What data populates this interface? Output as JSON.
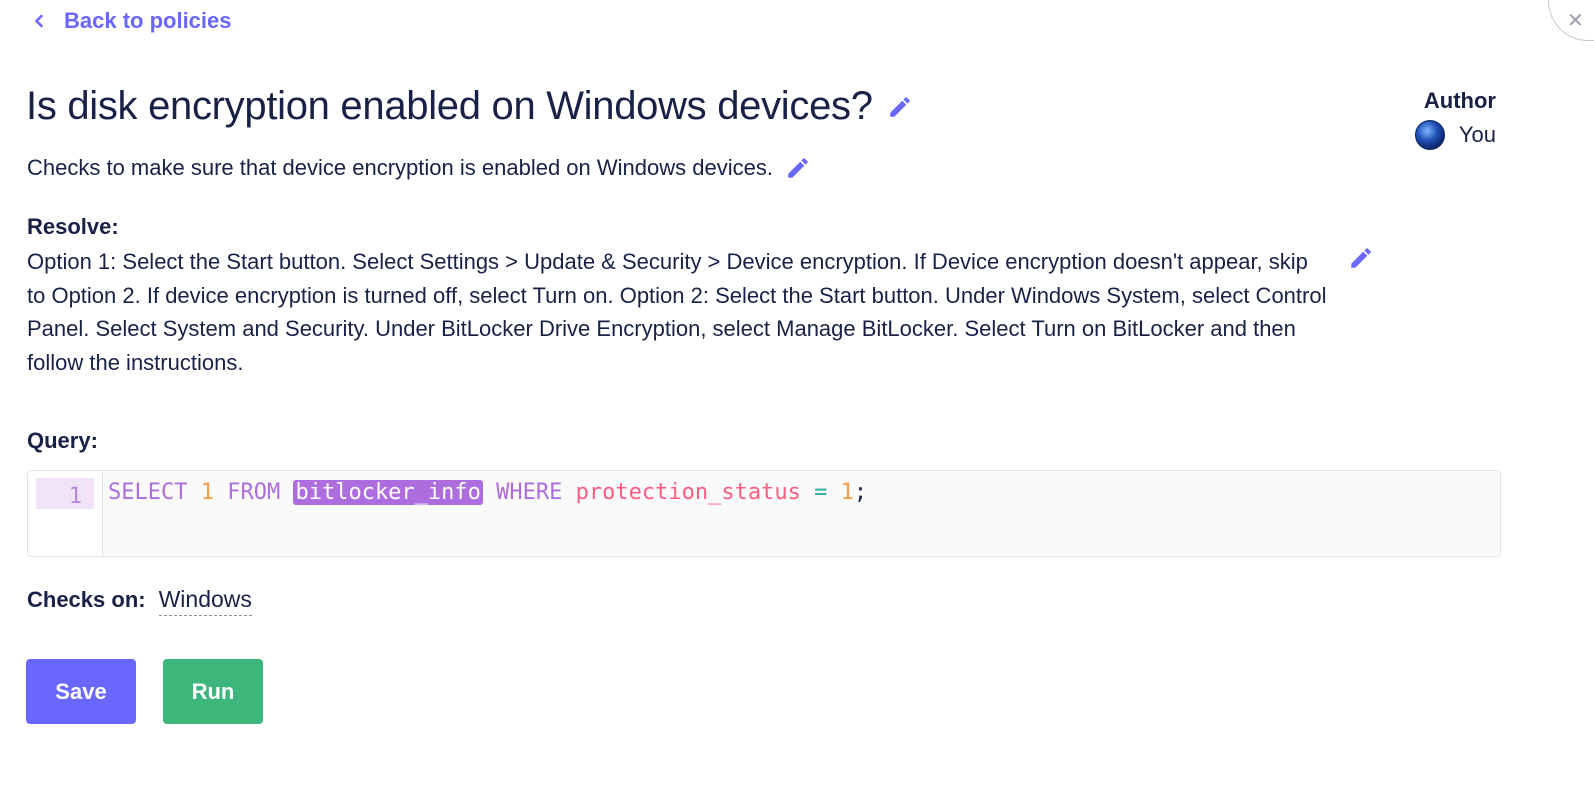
{
  "nav": {
    "back_label": "Back to policies",
    "close_icon_glyph": "✕"
  },
  "policy": {
    "title": "Is disk encryption enabled on Windows devices?",
    "description": "Checks to make sure that device encryption is enabled on Windows devices.",
    "resolve_label": "Resolve:",
    "resolve_text": "Option 1: Select the Start button. Select Settings > Update & Security > Device encryption. If Device encryption doesn't appear, skip to Option 2. If device encryption is turned off, select Turn on. Option 2: Select the Start button. Under Windows System, select Control Panel. Select System and Security. Under BitLocker Drive Encryption, select Manage BitLocker. Select Turn on BitLocker and then follow the instructions.",
    "query_label": "Query:",
    "checks_on_label": "Checks on:",
    "checks_on_value": "Windows"
  },
  "author": {
    "label": "Author",
    "name": "You"
  },
  "query": {
    "line_number": "1",
    "tokens": {
      "select": "SELECT",
      "one": "1",
      "from": "FROM",
      "table": "bitlocker_info",
      "where": "WHERE",
      "column": "protection_status",
      "equals": "=",
      "value": "1",
      "terminator": ";"
    }
  },
  "actions": {
    "save_label": "Save",
    "run_label": "Run"
  },
  "colors": {
    "accent": "#6a67fe",
    "run_green": "#3db67b",
    "text": "#192147",
    "keyword": "#ae6ddf",
    "number": "#ff9b46",
    "column": "#ff5c82"
  },
  "icons": {
    "back": "chevron-left-icon",
    "edit": "pencil-icon",
    "close": "close-icon"
  }
}
